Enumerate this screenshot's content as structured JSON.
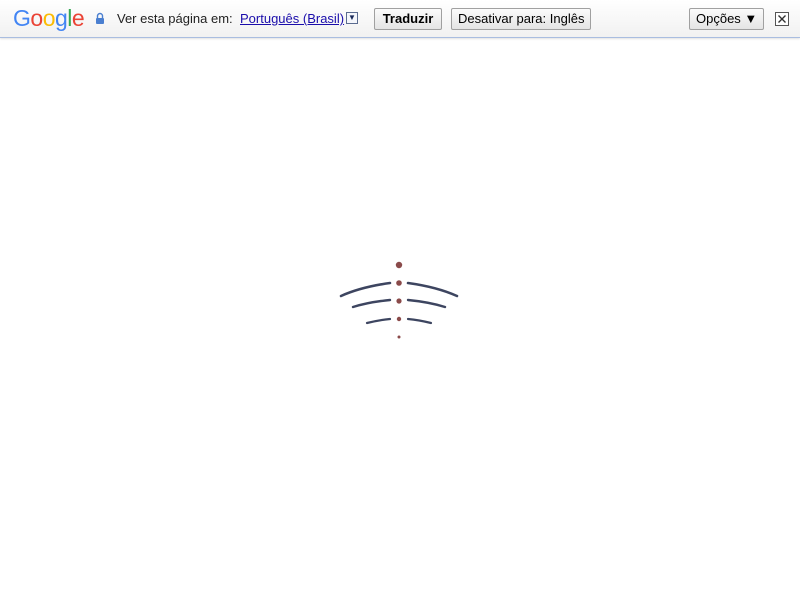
{
  "translate_bar": {
    "logo_letters": [
      "G",
      "o",
      "o",
      "g",
      "l",
      "e"
    ],
    "prompt": "Ver esta página em:",
    "language_link": "Português (Brasil)",
    "dropdown_glyph": "▼",
    "translate_button": "Traduzir",
    "disable_button": "Desativar para: Inglês",
    "options_button": "Opções ▼"
  },
  "icons": {
    "lock": "lock-icon",
    "close": "close-icon",
    "loader": "loading-spinner-icon"
  },
  "colors": {
    "link": "#1a0dab",
    "loader_dots": "#8a4a4a",
    "loader_arcs": "#3d4560"
  }
}
